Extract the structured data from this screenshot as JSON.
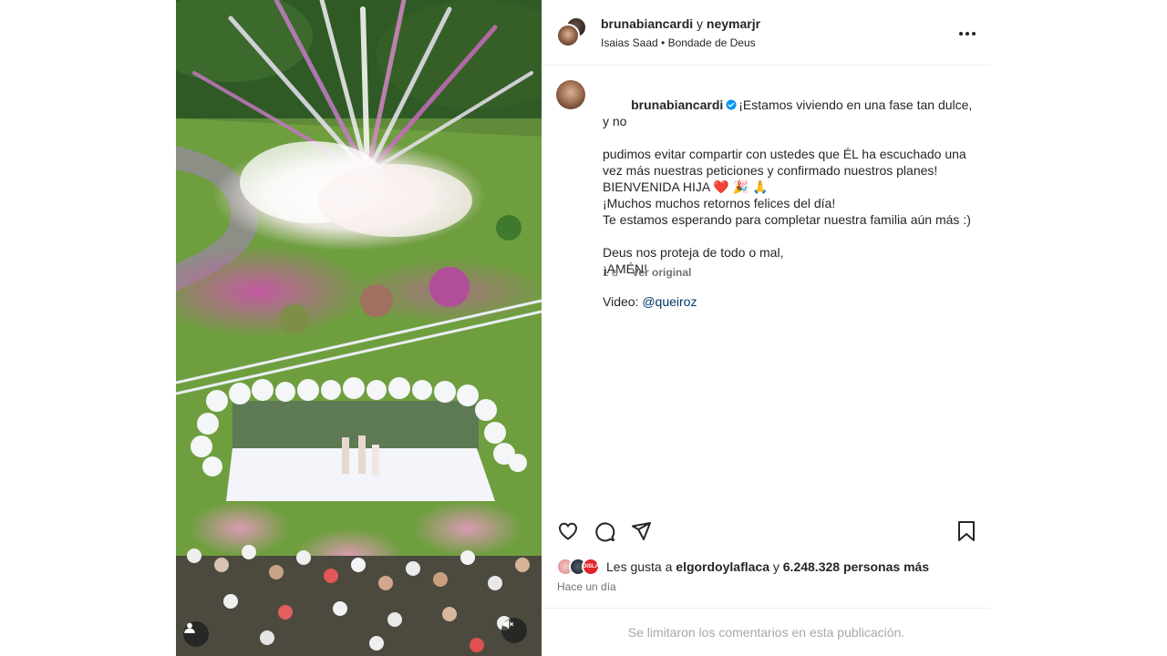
{
  "post": {
    "header": {
      "usernames": "brunabiancardi",
      "conjunction": "y",
      "coauthor": "neymarjr",
      "audio": "Isaias Saad • Bondade de Deus"
    },
    "caption": {
      "username": "brunabiancardi",
      "lines": [
        "¡Estamos viviendo en una fase tan dulce, y no",
        "pudimos evitar compartir con ustedes que ÉL ha escuchado una",
        "vez más nuestras peticiones y confirmado nuestros planes!",
        "BIENVENIDA HIJA ❤️ 🎉 🙏",
        "¡Muchos muchos retornos felices del día!",
        "Te estamos esperando para completar nuestra familia aún más :)",
        "",
        "Deus nos proteja de todo o mal,",
        "¡AMÉN!",
        "",
        "Video: "
      ],
      "mention": "@queiroz",
      "age": "1 d",
      "see_original": "Ver original"
    },
    "likes": {
      "prefix": "Les gusta a",
      "user": "elgordoylaflaca",
      "joiner": "y",
      "count_text": "6.248.328 personas más",
      "avatar_badge": "DISLA"
    },
    "time_ago": "Hace un día",
    "comments_notice": "Se limitaron los comentarios en esta publicación."
  },
  "colors": {
    "verified": "#0095f6",
    "heart": "#ed4956",
    "link": "#00376b",
    "secondary_text": "#737373"
  },
  "icons": [
    "tag-user-icon",
    "mute-icon",
    "more-options-icon",
    "verified-badge-icon",
    "like-heart-icon",
    "comment-icon",
    "share-icon",
    "save-bookmark-icon"
  ]
}
